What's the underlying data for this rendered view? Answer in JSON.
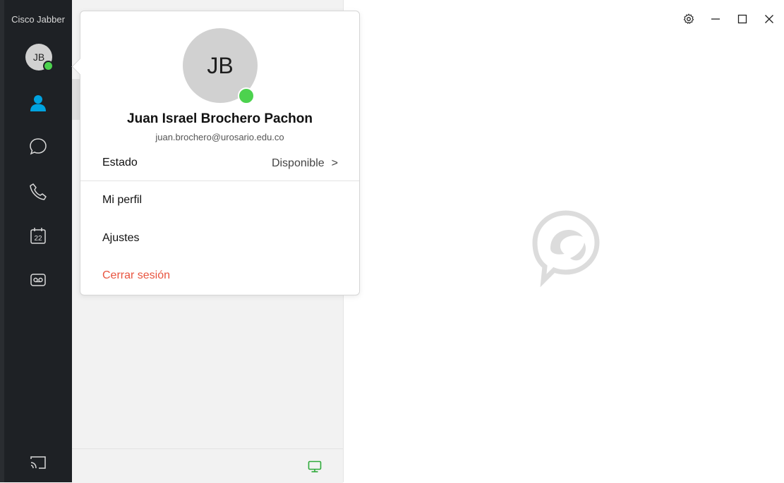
{
  "app": {
    "title": "Cisco Jabber"
  },
  "user": {
    "initials": "JB",
    "name": "Juan Israel Brochero Pachon",
    "email": "juan.brochero@urosario.edu.co",
    "presence_color": "#4cd24e"
  },
  "popup": {
    "status_label": "Estado",
    "status_value": "Disponible",
    "status_chevron": ">",
    "menu": {
      "profile": "Mi perfil",
      "settings": "Ajustes",
      "logout": "Cerrar sesión"
    }
  },
  "sidebar": {
    "calendar_day": "22",
    "icons": [
      "contacts-icon",
      "chat-icon",
      "phone-icon",
      "calendar-icon",
      "voicemail-icon",
      "cast-icon"
    ]
  },
  "colors": {
    "accent": "#00a3e0",
    "logout": "#e8543f",
    "sidebar_bg": "#1e2125",
    "desk_status_icon": "#2eaa3a"
  }
}
